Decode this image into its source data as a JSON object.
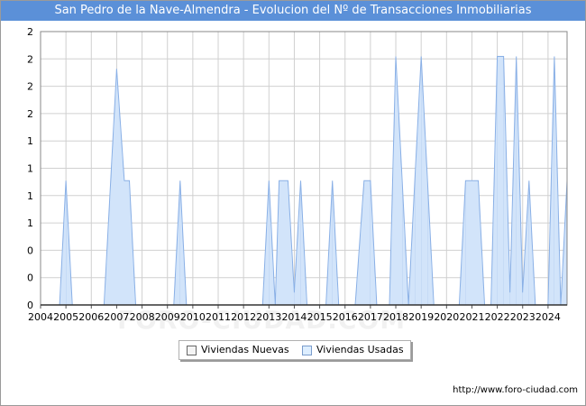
{
  "header": {
    "title": "San Pedro de la Nave-Almendra - Evolucion del Nº de Transacciones Inmobiliarias"
  },
  "footer": {
    "url": "http://www.foro-ciudad.com"
  },
  "watermark": {
    "text": "FORO-CIUDAD.COM"
  },
  "legend": {
    "position": "bottom-center"
  },
  "colors": {
    "title_bg": "#5b90d8",
    "usadas_fill": "#ddeeff",
    "usadas_line": "#8ab0e6",
    "nuevas_fill": "#f4f4f4",
    "grid": "#d0d0d0"
  },
  "chart_data": {
    "type": "area",
    "title": "San Pedro de la Nave-Almendra - Evolucion del Nº de Transacciones Inmobiliarias",
    "xlabel": "",
    "ylabel": "",
    "grid": true,
    "x_ticks": [
      "2004",
      "2005",
      "2006",
      "2007",
      "2008",
      "2009",
      "2010",
      "2011",
      "2012",
      "2013",
      "2014",
      "2015",
      "2016",
      "2017",
      "2018",
      "2019",
      "2020",
      "2021",
      "2022",
      "2023",
      "2024"
    ],
    "y_tick_labels": [
      "0",
      "0",
      "0",
      "1",
      "1",
      "1",
      "1",
      "2",
      "2",
      "2",
      "2"
    ],
    "ylim": [
      0,
      2.2
    ],
    "x_range": [
      2004,
      2024.75
    ],
    "series": [
      {
        "name": "Viviendas Nuevas",
        "points": []
      },
      {
        "name": "Viviendas Usadas",
        "points": [
          [
            2004.75,
            0
          ],
          [
            2005.0,
            1.0
          ],
          [
            2005.25,
            0
          ],
          [
            2006.5,
            0
          ],
          [
            2007.0,
            1.9
          ],
          [
            2007.3,
            1.0
          ],
          [
            2007.5,
            1.0
          ],
          [
            2007.75,
            0
          ],
          [
            2009.25,
            0
          ],
          [
            2009.5,
            1.0
          ],
          [
            2009.75,
            0
          ],
          [
            2012.75,
            0
          ],
          [
            2013.0,
            1.0
          ],
          [
            2013.25,
            0
          ],
          [
            2013.4,
            1.0
          ],
          [
            2013.75,
            1.0
          ],
          [
            2014.0,
            0.1
          ],
          [
            2014.25,
            1.0
          ],
          [
            2014.5,
            0
          ],
          [
            2015.25,
            0
          ],
          [
            2015.5,
            1.0
          ],
          [
            2015.75,
            0
          ],
          [
            2016.4,
            0
          ],
          [
            2016.75,
            1.0
          ],
          [
            2017.0,
            1.0
          ],
          [
            2017.25,
            0
          ],
          [
            2017.75,
            0
          ],
          [
            2018.0,
            2.0
          ],
          [
            2018.25,
            1.0
          ],
          [
            2018.5,
            0
          ],
          [
            2018.75,
            1.0
          ],
          [
            2019.0,
            2.0
          ],
          [
            2019.25,
            1.0
          ],
          [
            2019.5,
            0
          ],
          [
            2020.5,
            0
          ],
          [
            2020.75,
            1.0
          ],
          [
            2021.25,
            1.0
          ],
          [
            2021.5,
            0
          ],
          [
            2021.75,
            0
          ],
          [
            2022.0,
            2.0
          ],
          [
            2022.25,
            2.0
          ],
          [
            2022.5,
            0.1
          ],
          [
            2022.75,
            2.0
          ],
          [
            2023.0,
            0.1
          ],
          [
            2023.25,
            1.0
          ],
          [
            2023.5,
            0
          ],
          [
            2024.0,
            0
          ],
          [
            2024.25,
            2.0
          ],
          [
            2024.5,
            0
          ],
          [
            2024.75,
            1.0
          ]
        ]
      }
    ]
  }
}
